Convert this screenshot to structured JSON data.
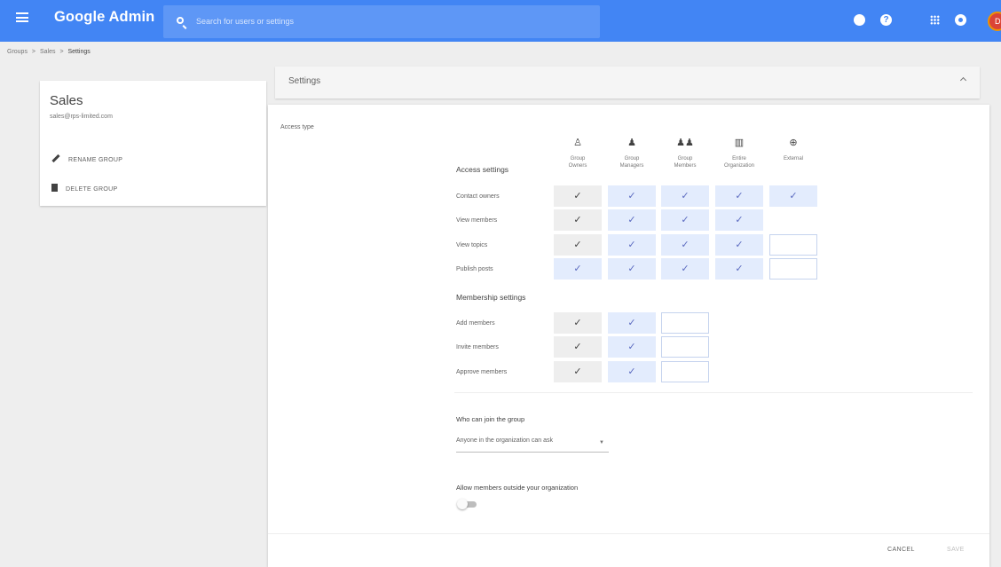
{
  "header": {
    "brand": "Google Admin",
    "search_placeholder": "Search for users or settings",
    "help_glyph": "?",
    "avatar_letter": "D"
  },
  "breadcrumb": [
    "Groups",
    ">",
    "Sales",
    ">",
    "Settings"
  ],
  "group": {
    "name": "Sales",
    "email": "sales@rps-limited.com",
    "rename_label": "RENAME GROUP",
    "delete_label": "DELETE GROUP"
  },
  "settings": {
    "title": "Settings",
    "access_type_label": "Access type",
    "columns": [
      {
        "line1": "Group",
        "line2": "Owners",
        "icon": "person-outline-icon"
      },
      {
        "line1": "Group",
        "line2": "Managers",
        "icon": "person-icon"
      },
      {
        "line1": "Group",
        "line2": "Members",
        "icon": "people-icon"
      },
      {
        "line1": "Entire",
        "line2": "Organization",
        "icon": "building-icon"
      },
      {
        "line1": "External",
        "line2": "",
        "icon": "globe-icon"
      }
    ],
    "access_settings_label": "Access settings",
    "access_rows": [
      {
        "label": "Contact owners",
        "cells": [
          "check-grey",
          "check-blue",
          "check-blue",
          "check-blue",
          "check-blue"
        ]
      },
      {
        "label": "View members",
        "cells": [
          "check-grey",
          "check-blue",
          "check-blue",
          "check-blue",
          "none"
        ]
      },
      {
        "label": "View topics",
        "cells": [
          "check-grey",
          "check-blue",
          "check-blue",
          "check-blue",
          "empty"
        ]
      },
      {
        "label": "Publish posts",
        "cells": [
          "check-blue",
          "check-blue",
          "check-blue",
          "check-blue",
          "empty"
        ]
      }
    ],
    "membership_settings_label": "Membership settings",
    "membership_rows": [
      {
        "label": "Add members",
        "cells": [
          "check-grey",
          "check-blue",
          "empty"
        ]
      },
      {
        "label": "Invite members",
        "cells": [
          "check-grey",
          "check-blue",
          "empty"
        ]
      },
      {
        "label": "Approve members",
        "cells": [
          "check-grey",
          "check-blue",
          "empty"
        ]
      }
    ],
    "check_glyph": "✓",
    "join_label": "Who can join the group",
    "join_value": "Anyone in the organization can ask",
    "allow_outside_label": "Allow members outside your organization",
    "allow_outside_enabled": false,
    "cancel_label": "CANCEL",
    "save_label": "SAVE"
  },
  "colors": {
    "brand": "#4285f4",
    "checked_blue": "#e3ecfd",
    "checked_grey": "#eeeeee"
  }
}
